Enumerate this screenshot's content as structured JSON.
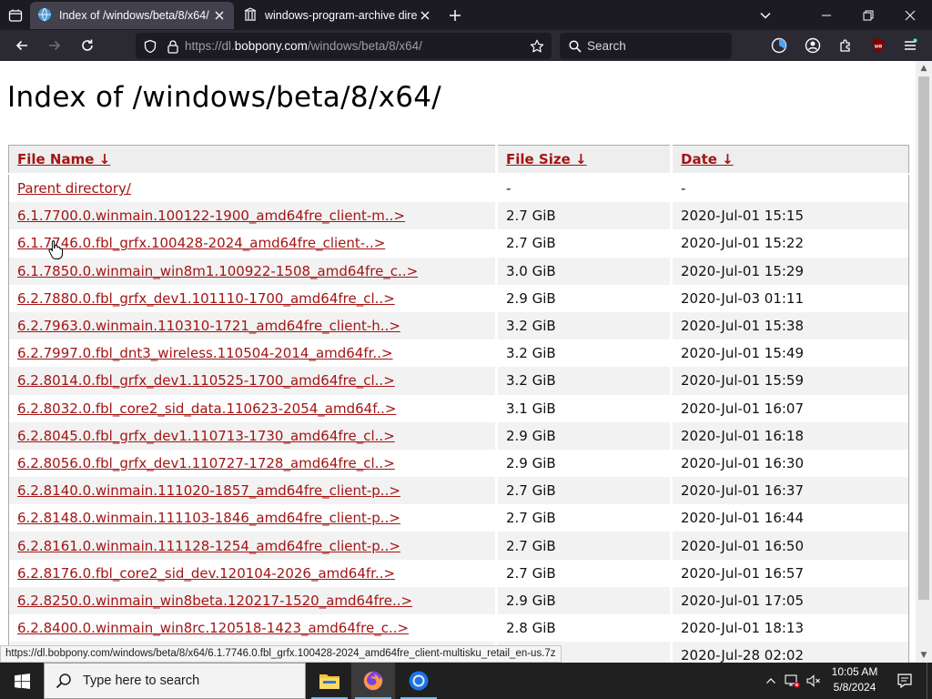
{
  "browser": {
    "tabs": [
      {
        "title": "Index of /windows/beta/8/x64/",
        "active": true
      },
      {
        "title": "windows-program-archive direc",
        "active": false
      }
    ],
    "url_prefix": "https://dl.",
    "url_host": "bobpony.com",
    "url_path": "/windows/beta/8/x64/",
    "search_placeholder": "Search",
    "accent": "#1c1b22"
  },
  "page": {
    "title": "Index of /windows/beta/8/x64/",
    "columns": {
      "name": "File Name ↓",
      "size": "File Size ↓",
      "date": "Date ↓"
    },
    "link_color": "#a31515",
    "rows": [
      {
        "name": "Parent directory/",
        "size": "-",
        "date": "-"
      },
      {
        "name": "6.1.7700.0.winmain.100122-1900_amd64fre_client-m..>",
        "size": "2.7 GiB",
        "date": "2020-Jul-01 15:15"
      },
      {
        "name": "6.1.7746.0.fbl_grfx.100428-2024_amd64fre_client-..>",
        "size": "2.7 GiB",
        "date": "2020-Jul-01 15:22"
      },
      {
        "name": "6.1.7850.0.winmain_win8m1.100922-1508_amd64fre_c..>",
        "size": "3.0 GiB",
        "date": "2020-Jul-01 15:29"
      },
      {
        "name": "6.2.7880.0.fbl_grfx_dev1.101110-1700_amd64fre_cl..>",
        "size": "2.9 GiB",
        "date": "2020-Jul-03 01:11"
      },
      {
        "name": "6.2.7963.0.winmain.110310-1721_amd64fre_client-h..>",
        "size": "3.2 GiB",
        "date": "2020-Jul-01 15:38"
      },
      {
        "name": "6.2.7997.0.fbl_dnt3_wireless.110504-2014_amd64fr..>",
        "size": "3.2 GiB",
        "date": "2020-Jul-01 15:49"
      },
      {
        "name": "6.2.8014.0.fbl_grfx_dev1.110525-1700_amd64fre_cl..>",
        "size": "3.2 GiB",
        "date": "2020-Jul-01 15:59"
      },
      {
        "name": "6.2.8032.0.fbl_core2_sid_data.110623-2054_amd64f..>",
        "size": "3.1 GiB",
        "date": "2020-Jul-01 16:07"
      },
      {
        "name": "6.2.8045.0.fbl_grfx_dev1.110713-1730_amd64fre_cl..>",
        "size": "2.9 GiB",
        "date": "2020-Jul-01 16:18"
      },
      {
        "name": "6.2.8056.0.fbl_grfx_dev1.110727-1728_amd64fre_cl..>",
        "size": "2.9 GiB",
        "date": "2020-Jul-01 16:30"
      },
      {
        "name": "6.2.8140.0.winmain.111020-1857_amd64fre_client-p..>",
        "size": "2.7 GiB",
        "date": "2020-Jul-01 16:37"
      },
      {
        "name": "6.2.8148.0.winmain.111103-1846_amd64fre_client-p..>",
        "size": "2.7 GiB",
        "date": "2020-Jul-01 16:44"
      },
      {
        "name": "6.2.8161.0.winmain.111128-1254_amd64fre_client-p..>",
        "size": "2.7 GiB",
        "date": "2020-Jul-01 16:50"
      },
      {
        "name": "6.2.8176.0.fbl_core2_sid_dev.120104-2026_amd64fr..>",
        "size": "2.7 GiB",
        "date": "2020-Jul-01 16:57"
      },
      {
        "name": "6.2.8250.0.winmain_win8beta.120217-1520_amd64fre..>",
        "size": "2.9 GiB",
        "date": "2020-Jul-01 17:05"
      },
      {
        "name": "6.2.8400.0.winmain_win8rc.120518-1423_amd64fre_c..>",
        "size": "2.8 GiB",
        "date": "2020-Jul-01 18:13"
      },
      {
        "name": "",
        "size": "",
        "date": "2020-Jul-28 02:02"
      }
    ]
  },
  "status_url": "https://dl.bobpony.com/windows/beta/8/x64/6.1.7746.0.fbl_grfx.100428-2024_amd64fre_client-multisku_retail_en-us.7z",
  "taskbar": {
    "search_placeholder": "Type here to search",
    "time": "10:05 AM",
    "date": "5/8/2024"
  }
}
